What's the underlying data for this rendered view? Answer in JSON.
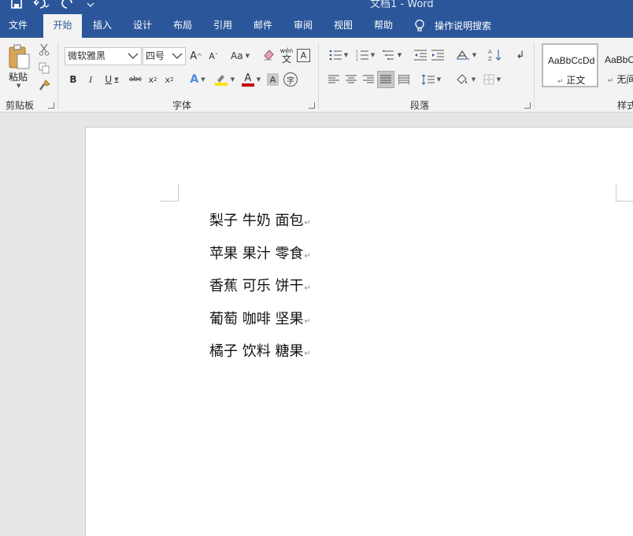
{
  "titlebar": {
    "title": "文档1 - Word"
  },
  "tabs": [
    {
      "label": "文件",
      "left": 0
    },
    {
      "label": "开始",
      "active": true
    },
    {
      "label": "插入"
    },
    {
      "label": "设计"
    },
    {
      "label": "布局"
    },
    {
      "label": "引用"
    },
    {
      "label": "邮件"
    },
    {
      "label": "审阅"
    },
    {
      "label": "视图"
    },
    {
      "label": "帮助"
    }
  ],
  "search": {
    "label": "操作说明搜索"
  },
  "clipboard": {
    "paste_label": "粘贴",
    "group_label": "剪贴板"
  },
  "font": {
    "font_name": "微软雅黑",
    "font_size": "四号",
    "group_label": "字体",
    "change_case": "Aa",
    "phonetic": "wén"
  },
  "paragraph": {
    "group_label": "段落"
  },
  "styles": {
    "group_label": "样式",
    "items": [
      {
        "sample": "AaBbCcDd",
        "name": "正文"
      },
      {
        "sample": "AaBbCcDd",
        "name": "无间"
      }
    ]
  },
  "document": {
    "lines": [
      "梨子 牛奶 面包",
      "苹果 果汁 零食",
      "香蕉 可乐 饼干",
      "葡萄 咖啡 坚果",
      "橘子 饮料 糖果"
    ],
    "para_mark": "↵"
  },
  "colors": {
    "brand": "#2b579a",
    "ribbon_bg": "#f3f3f3",
    "highlight": "#ffe000",
    "font_color": "#c00000"
  }
}
